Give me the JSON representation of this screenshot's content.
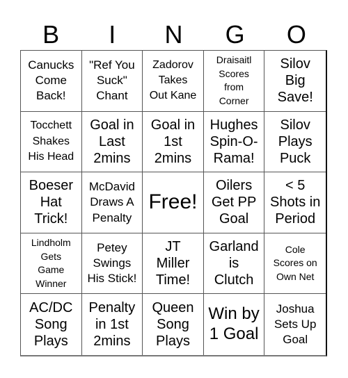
{
  "header": [
    "B",
    "I",
    "N",
    "G",
    "O"
  ],
  "cells": [
    {
      "text": "Canucks Come Back!",
      "lines": [
        "Canucks",
        "Come",
        "Back!"
      ],
      "size": "m"
    },
    {
      "text": "\"Ref You Suck\" Chant",
      "lines": [
        "\"Ref You",
        "Suck\"",
        "Chant"
      ],
      "size": "m"
    },
    {
      "text": "Zadorov Takes Out Kane",
      "lines": [
        "Zadorov",
        "Takes",
        "Out Kane"
      ],
      "size": "s"
    },
    {
      "text": "Draisaitl Scores from Corner",
      "lines": [
        "Draisaitl",
        "Scores",
        "from",
        "Corner"
      ],
      "size": "xs"
    },
    {
      "text": "Silov Big Save!",
      "lines": [
        "Silov",
        "Big",
        "Save!"
      ],
      "size": "l"
    },
    {
      "text": "Tocchett Shakes His Head",
      "lines": [
        "Tocchett",
        "Shakes",
        "His Head"
      ],
      "size": "s"
    },
    {
      "text": "Goal in Last 2mins",
      "lines": [
        "Goal in",
        "Last",
        "2mins"
      ],
      "size": "l"
    },
    {
      "text": "Goal in 1st 2mins",
      "lines": [
        "Goal in",
        "1st",
        "2mins"
      ],
      "size": "l"
    },
    {
      "text": "Hughes Spin-O-Rama!",
      "lines": [
        "Hughes",
        "Spin-O-",
        "Rama!"
      ],
      "size": "l"
    },
    {
      "text": "Silov Plays Puck",
      "lines": [
        "Silov",
        "Plays",
        "Puck"
      ],
      "size": "l"
    },
    {
      "text": "Boeser Hat Trick!",
      "lines": [
        "Boeser",
        "Hat",
        "Trick!"
      ],
      "size": "l"
    },
    {
      "text": "McDavid Draws A Penalty",
      "lines": [
        "McDavid",
        "Draws A",
        "Penalty"
      ],
      "size": "m"
    },
    {
      "text": "Free!",
      "lines": [
        "Free!"
      ],
      "size": "xl",
      "free": true
    },
    {
      "text": "Oilers Get PP Goal",
      "lines": [
        "Oilers",
        "Get PP",
        "Goal"
      ],
      "size": "l"
    },
    {
      "text": "< 5 Shots in Period",
      "lines": [
        "< 5",
        "Shots in",
        "Period"
      ],
      "size": "l"
    },
    {
      "text": "Lindholm Gets Game Winner",
      "lines": [
        "Lindholm",
        "Gets",
        "Game",
        "Winner"
      ],
      "size": "xs"
    },
    {
      "text": "Petey Swings His Stick!",
      "lines": [
        "Petey",
        "Swings",
        "His Stick!"
      ],
      "size": "m"
    },
    {
      "text": "JT Miller Time!",
      "lines": [
        "JT",
        "Miller",
        "Time!"
      ],
      "size": "l"
    },
    {
      "text": "Garland is Clutch",
      "lines": [
        "Garland",
        "is",
        "Clutch"
      ],
      "size": "l"
    },
    {
      "text": "Cole Scores on Own Net",
      "lines": [
        "Cole",
        "Scores on",
        "Own Net"
      ],
      "size": "xs"
    },
    {
      "text": "AC/DC Song Plays",
      "lines": [
        "AC/DC",
        "Song",
        "Plays"
      ],
      "size": "l"
    },
    {
      "text": "Penalty in 1st 2mins",
      "lines": [
        "Penalty",
        "in 1st",
        "2mins"
      ],
      "size": "l"
    },
    {
      "text": "Queen Song Plays",
      "lines": [
        "Queen",
        "Song",
        "Plays"
      ],
      "size": "l"
    },
    {
      "text": "Win by 1 Goal",
      "lines": [
        "Win by",
        "1 Goal"
      ],
      "size": "xl2"
    },
    {
      "text": "Joshua Sets Up Goal",
      "lines": [
        "Joshua",
        "Sets Up",
        "Goal"
      ],
      "size": "m"
    }
  ]
}
